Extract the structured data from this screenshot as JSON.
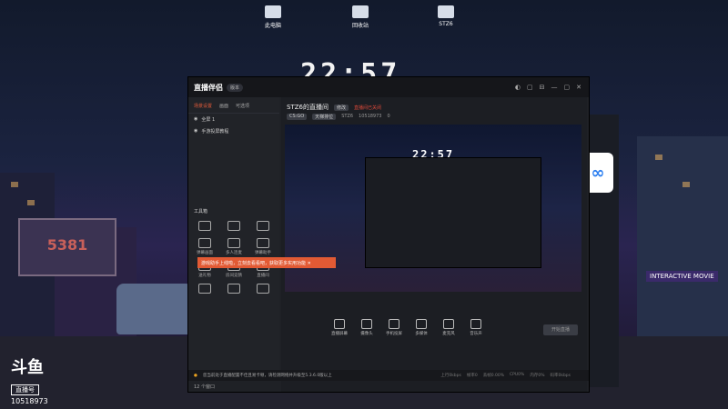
{
  "desktop": {
    "icons": [
      {
        "label": "此电脑",
        "icon": "computer-icon"
      },
      {
        "label": "回收站",
        "icon": "recycle-bin-icon"
      },
      {
        "label": "STZ6",
        "icon": "drive-icon"
      }
    ],
    "clock": "22:57",
    "brand": {
      "logo": "斗鱼",
      "tag": "直播号",
      "room_id": "10518973"
    },
    "city_signs": [
      "INTERACTIVE MOVIE",
      "5381"
    ]
  },
  "app": {
    "title": "直播伴侣",
    "version_badge": "版本",
    "window_controls": [
      "◐",
      "▢",
      "⊟",
      "—",
      "▢",
      "✕"
    ],
    "left_panel": {
      "tabs": [
        "场景设置",
        "画面",
        "可选项"
      ],
      "active_tab": 0,
      "scenes": [
        {
          "label": "全屏 1"
        },
        {
          "label": "手游投屏教程"
        }
      ],
      "tools_title": "工具箱",
      "tools": [
        {
          "label": ""
        },
        {
          "label": ""
        },
        {
          "label": ""
        },
        {
          "label": "弹幕画面"
        },
        {
          "label": "多人连麦"
        },
        {
          "label": "弹幕助手"
        },
        {
          "label": "送礼物"
        },
        {
          "label": "房间竞猜"
        },
        {
          "label": "直播间"
        },
        {
          "label": ""
        },
        {
          "label": ""
        },
        {
          "label": ""
        }
      ],
      "toast": "游戏助手上线啦，立刻去看看吧，获取更多实用功能 ✕"
    },
    "room": {
      "title": "STZ6的直播间",
      "badge": "修改",
      "red_note": "直播间已关闭",
      "category": "CS:GO",
      "level_badge": "天梯排位",
      "owner": "STZ6",
      "room_id": "10518973",
      "fans": "0"
    },
    "preview": {
      "clock": "22:57"
    },
    "actions": [
      {
        "label": "直播屏幕"
      },
      {
        "label": "摄像头"
      },
      {
        "label": "手机投屏"
      },
      {
        "label": "多媒体"
      },
      {
        "label": "麦克风"
      },
      {
        "label": "音乐声"
      }
    ],
    "start_button": "开始直播",
    "status_bar": {
      "warning": "您当前处于直播配置不佳且易卡顿，请检测网络并升级至5.3.6.0版以上",
      "stats": [
        "上行0kbps",
        "帧率0",
        "丢帧0.00%",
        "CPU0%",
        "内存0%",
        "码率0kbps"
      ]
    },
    "bottom_count": "12 个窗口"
  }
}
